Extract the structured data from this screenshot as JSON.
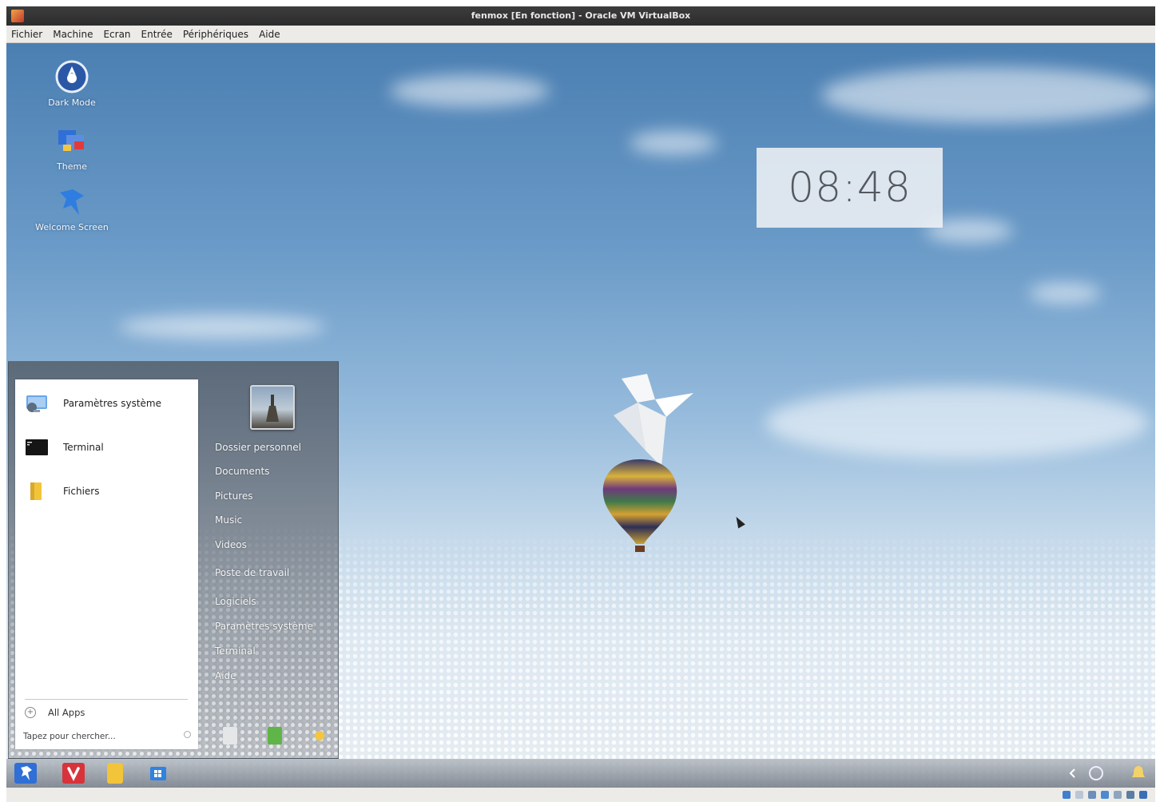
{
  "window": {
    "title": "fenmox [En fonction] - Oracle VM VirtualBox"
  },
  "menubar": {
    "items": [
      "Fichier",
      "Machine",
      "Ecran",
      "Entrée",
      "Périphériques",
      "Aide"
    ]
  },
  "desktop": {
    "icons": [
      {
        "label": "Dark Mode",
        "icon": "dark-mode-icon"
      },
      {
        "label": "Theme",
        "icon": "theme-icon"
      },
      {
        "label": "Welcome Screen",
        "icon": "welcome-screen-icon"
      }
    ],
    "clock": "08:48"
  },
  "start_menu": {
    "pinned": [
      {
        "label": "Paramètres système",
        "icon": "settings-icon"
      },
      {
        "label": "Terminal",
        "icon": "terminal-icon"
      },
      {
        "label": "Fichiers",
        "icon": "folder-icon"
      }
    ],
    "all_apps_label": "All Apps",
    "search_placeholder": "Tapez pour chercher...",
    "places": [
      "Dossier personnel",
      "Documents",
      "Pictures",
      "Music",
      "Videos",
      "Poste de travail",
      "Logiciels",
      "Paramètres système",
      "Terminal",
      "Aide"
    ],
    "power_buttons": [
      "lock-icon",
      "logout-icon",
      "power-icon"
    ]
  },
  "taskbar": {
    "items": [
      "start-menu-icon",
      "vivaldi-icon",
      "files-icon",
      "windows-store-icon"
    ]
  },
  "colors": {
    "accent": "#2f6fd6",
    "vivaldi": "#d8333b",
    "folder": "#f2c43a"
  }
}
